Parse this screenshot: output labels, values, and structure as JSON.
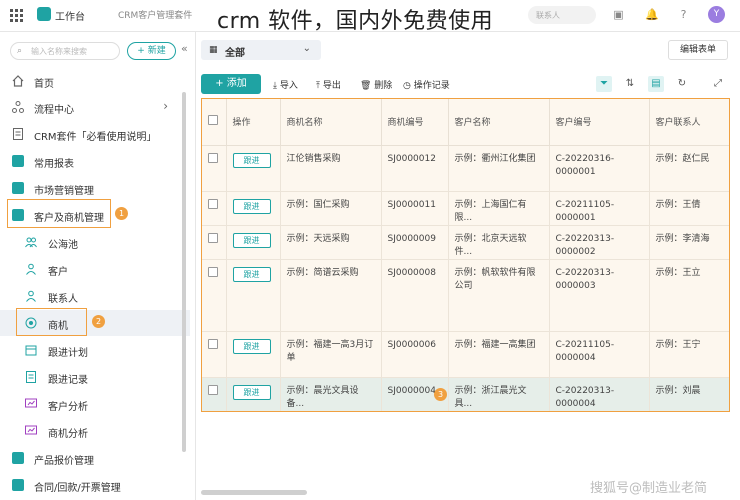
{
  "topbar": {
    "app_name": "工作台",
    "tab_name": "CRM客户管理套件",
    "overlay_title": "crm 软件，国内外免费使用",
    "search_placeholder": "联系人",
    "avatar_letter": "Y"
  },
  "sidebar": {
    "search_placeholder": "输入名称来搜索",
    "new_button": "+ 新建",
    "items": [
      {
        "label": "首页",
        "icon": "home-icon"
      },
      {
        "label": "流程中心",
        "icon": "flow-icon"
      },
      {
        "label": "CRM套件「必看使用说明」",
        "icon": "doc-icon"
      },
      {
        "label": "常用报表",
        "icon": "folder-icon"
      },
      {
        "label": "市场营销管理",
        "icon": "folder-icon"
      },
      {
        "label": "客户及商机管理",
        "icon": "folder-icon"
      },
      {
        "label": "公海池",
        "icon": "people-icon"
      },
      {
        "label": "客户",
        "icon": "person-icon"
      },
      {
        "label": "联系人",
        "icon": "person-icon"
      },
      {
        "label": "商机",
        "icon": "target-icon"
      },
      {
        "label": "跟进计划",
        "icon": "calendar-icon"
      },
      {
        "label": "跟进记录",
        "icon": "record-icon"
      },
      {
        "label": "客户分析",
        "icon": "chart-icon"
      },
      {
        "label": "商机分析",
        "icon": "chart-icon"
      },
      {
        "label": "产品报价管理",
        "icon": "folder-icon"
      },
      {
        "label": "合同/回款/开票管理",
        "icon": "folder-icon"
      }
    ],
    "badges": [
      "1",
      "2"
    ]
  },
  "main": {
    "view_label": "全部",
    "edit_form": "编辑表单",
    "add_button": "+ 添加",
    "tools": [
      "导入",
      "导出",
      "删除",
      "操作记录"
    ],
    "badge3": "3",
    "columns": [
      "操作",
      "商机名称",
      "商机编号",
      "客户名称",
      "客户编号",
      "客户联系人"
    ],
    "follow_label": "跟进",
    "rows": [
      {
        "name": "江伦销售采购",
        "code": "SJ0000012",
        "customer": "示例：衢州江化集团",
        "cust_code": "C-20220316-0000001",
        "contact": "示例：赵仁民"
      },
      {
        "name": "示例：国仁采购",
        "code": "SJ0000011",
        "customer": "示例：上海国仁有限...",
        "cust_code": "C-20211105-0000001",
        "contact": "示例：王倩"
      },
      {
        "name": "示例：天远采购",
        "code": "SJ0000009",
        "customer": "示例：北京天远软件...",
        "cust_code": "C-20220313-0000002",
        "contact": "示例：李清海"
      },
      {
        "name": "示例：简谱云采购",
        "code": "SJ0000008",
        "customer": "示例：帆软软件有限公司",
        "cust_code": "C-20220313-0000003",
        "contact": "示例：王立"
      },
      {
        "name": "示例：福建一高3月订单",
        "code": "SJ0000006",
        "customer": "示例：福建一高集团",
        "cust_code": "C-20211105-0000004",
        "contact": "示例：王宁"
      },
      {
        "name": "示例：晨光文具设备...",
        "code": "SJ0000004",
        "customer": "示例：浙江晨光文具...",
        "cust_code": "C-20220313-0000004",
        "contact": "示例：刘晨"
      }
    ]
  },
  "watermark": "搜狐号@制造业老简"
}
